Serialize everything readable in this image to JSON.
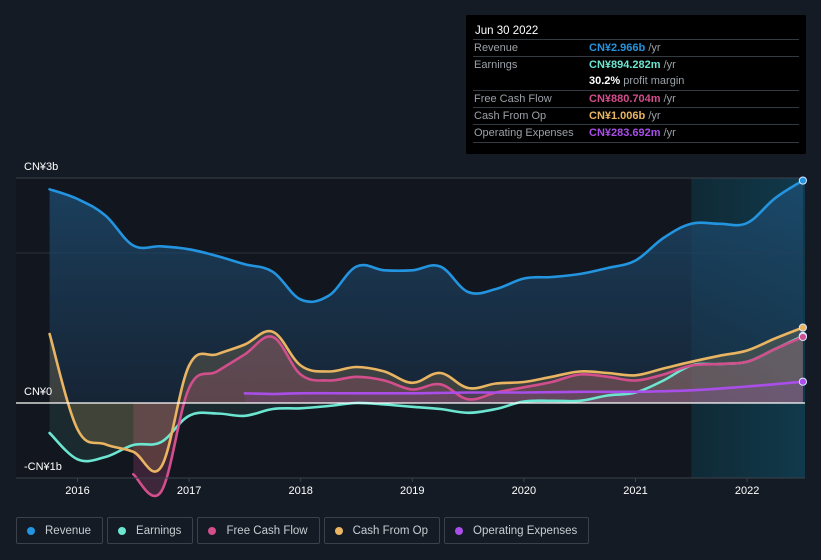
{
  "tooltip": {
    "date": "Jun 30 2022",
    "rows": [
      {
        "label": "Revenue",
        "value": "CN¥2.966b",
        "unit": " /yr",
        "color": "#2394df"
      },
      {
        "label": "Earnings",
        "value": "CN¥894.282m",
        "unit": " /yr",
        "color": "#6ce5d1"
      },
      {
        "label": "",
        "value": "30.2%",
        "unit": " profit margin",
        "color": "#ffffff"
      },
      {
        "label": "Free Cash Flow",
        "value": "CN¥880.704m",
        "unit": " /yr",
        "color": "#d24e8c"
      },
      {
        "label": "Cash From Op",
        "value": "CN¥1.006b",
        "unit": " /yr",
        "color": "#e9b562"
      },
      {
        "label": "Operating Expenses",
        "value": "CN¥283.692m",
        "unit": " /yr",
        "color": "#a94ee8"
      }
    ]
  },
  "legend": [
    {
      "label": "Revenue",
      "color": "#2394df"
    },
    {
      "label": "Earnings",
      "color": "#6ce5d1"
    },
    {
      "label": "Free Cash Flow",
      "color": "#d24e8c"
    },
    {
      "label": "Cash From Op",
      "color": "#e9b562"
    },
    {
      "label": "Operating Expenses",
      "color": "#a94ee8"
    }
  ],
  "chart_data": {
    "type": "line",
    "title": "",
    "xlabel": "",
    "ylabel": "",
    "unit": "CN¥ billions",
    "ylim": [
      -1.0,
      3.0
    ],
    "xlim": [
      2015.5,
      2022.5
    ],
    "y_tick_labels": [
      {
        "value": 3,
        "label": "CN¥3b"
      },
      {
        "value": 0,
        "label": "CN¥0"
      },
      {
        "value": -1,
        "label": "-CN¥1b"
      }
    ],
    "x_tick_labels": [
      "2016",
      "2017",
      "2018",
      "2019",
      "2020",
      "2021",
      "2022"
    ],
    "x_ticks": [
      2016,
      2017,
      2018,
      2019,
      2020,
      2021,
      2022
    ],
    "highlight_start": 2021.5,
    "grid": true,
    "legend_position": "bottom-left",
    "series": [
      {
        "name": "Revenue",
        "color": "#2394df",
        "x": [
          2015.75,
          2016.0,
          2016.25,
          2016.5,
          2016.75,
          2017.0,
          2017.25,
          2017.5,
          2017.75,
          2018.0,
          2018.25,
          2018.5,
          2018.75,
          2019.0,
          2019.25,
          2019.5,
          2019.75,
          2020.0,
          2020.25,
          2020.5,
          2020.75,
          2021.0,
          2021.25,
          2021.5,
          2021.75,
          2022.0,
          2022.25,
          2022.5
        ],
        "values": [
          2.85,
          2.72,
          2.5,
          2.1,
          2.09,
          2.05,
          1.96,
          1.85,
          1.75,
          1.38,
          1.43,
          1.82,
          1.77,
          1.77,
          1.82,
          1.48,
          1.52,
          1.66,
          1.68,
          1.72,
          1.8,
          1.9,
          2.2,
          2.39,
          2.39,
          2.4,
          2.73,
          2.966
        ]
      },
      {
        "name": "Earnings",
        "color": "#6ce5d1",
        "x": [
          2015.75,
          2016.0,
          2016.25,
          2016.5,
          2016.75,
          2017.0,
          2017.25,
          2017.5,
          2017.75,
          2018.0,
          2018.25,
          2018.5,
          2018.75,
          2019.0,
          2019.25,
          2019.5,
          2019.75,
          2020.0,
          2020.25,
          2020.5,
          2020.75,
          2021.0,
          2021.25,
          2021.5,
          2021.75,
          2022.0,
          2022.25,
          2022.5
        ],
        "values": [
          -0.4,
          -0.75,
          -0.72,
          -0.56,
          -0.52,
          -0.17,
          -0.14,
          -0.17,
          -0.08,
          -0.07,
          -0.04,
          0.0,
          -0.02,
          -0.05,
          -0.08,
          -0.13,
          -0.08,
          0.02,
          0.03,
          0.03,
          0.1,
          0.14,
          0.3,
          0.5,
          0.52,
          0.55,
          0.72,
          0.894
        ]
      },
      {
        "name": "Free Cash Flow",
        "color": "#d24e8c",
        "x": [
          2016.5,
          2016.75,
          2017.0,
          2017.25,
          2017.5,
          2017.75,
          2018.0,
          2018.25,
          2018.5,
          2018.75,
          2019.0,
          2019.25,
          2019.5,
          2019.75,
          2020.0,
          2020.25,
          2020.5,
          2020.75,
          2021.0,
          2021.25,
          2021.5,
          2021.75,
          2022.0,
          2022.25,
          2022.5
        ],
        "values": [
          -0.95,
          -1.18,
          0.2,
          0.42,
          0.65,
          0.88,
          0.38,
          0.3,
          0.35,
          0.3,
          0.18,
          0.25,
          0.05,
          0.14,
          0.21,
          0.28,
          0.38,
          0.35,
          0.3,
          0.38,
          0.5,
          0.52,
          0.55,
          0.72,
          0.881
        ]
      },
      {
        "name": "Cash From Op",
        "color": "#e9b562",
        "x": [
          2015.75,
          2016.0,
          2016.25,
          2016.5,
          2016.75,
          2017.0,
          2017.25,
          2017.5,
          2017.75,
          2018.0,
          2018.25,
          2018.5,
          2018.75,
          2019.0,
          2019.25,
          2019.5,
          2019.75,
          2020.0,
          2020.25,
          2020.5,
          2020.75,
          2021.0,
          2021.25,
          2021.5,
          2021.75,
          2022.0,
          2022.25,
          2022.5
        ],
        "values": [
          0.92,
          -0.35,
          -0.55,
          -0.65,
          -0.85,
          0.5,
          0.65,
          0.78,
          0.95,
          0.5,
          0.42,
          0.48,
          0.42,
          0.27,
          0.4,
          0.2,
          0.26,
          0.28,
          0.35,
          0.42,
          0.4,
          0.37,
          0.46,
          0.55,
          0.63,
          0.7,
          0.86,
          1.006
        ]
      },
      {
        "name": "Operating Expenses",
        "color": "#a94ee8",
        "x": [
          2017.5,
          2017.75,
          2018.0,
          2018.5,
          2019.0,
          2019.5,
          2020.0,
          2020.5,
          2021.0,
          2021.5,
          2022.0,
          2022.5
        ],
        "values": [
          0.13,
          0.12,
          0.13,
          0.13,
          0.13,
          0.14,
          0.14,
          0.15,
          0.15,
          0.17,
          0.22,
          0.284
        ]
      }
    ]
  }
}
